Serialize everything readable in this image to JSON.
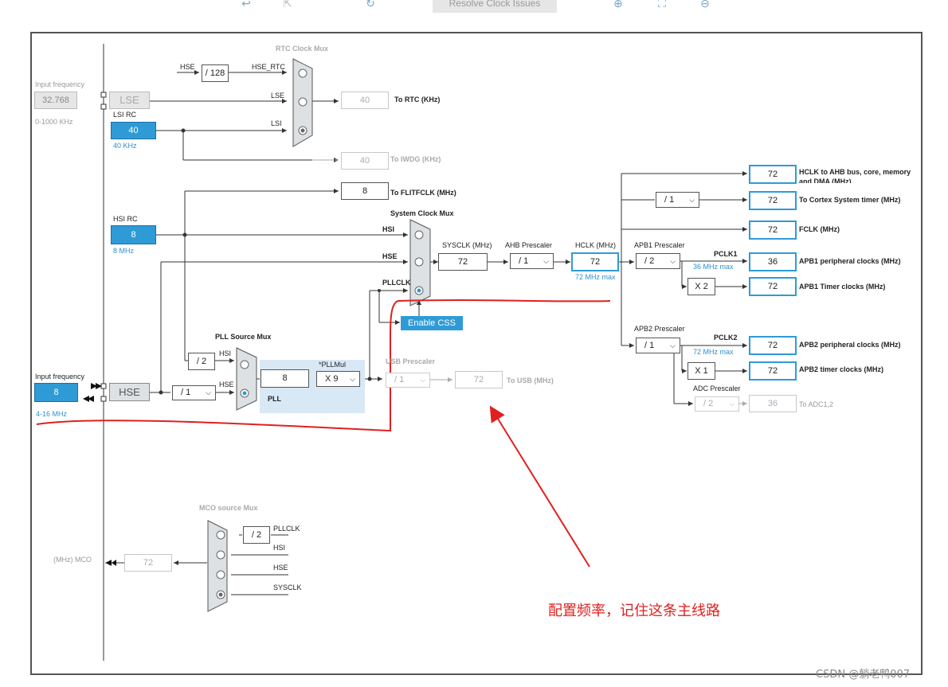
{
  "toolbar": {
    "resolve_label": "Resolve Clock Issues",
    "icons": [
      "undo-icon",
      "export-icon",
      "refresh-icon",
      "zoom-in-icon",
      "fit-icon",
      "zoom-out-icon"
    ]
  },
  "lse": {
    "input_label": "Input frequency",
    "value": "32.768",
    "range": "0-1000 KHz",
    "name": "LSE"
  },
  "lsi": {
    "name": "LSI RC",
    "value": "40",
    "unit": "40 KHz"
  },
  "rtc": {
    "mux_title": "RTC Clock Mux",
    "hse_label": "HSE",
    "div": "/ 128",
    "hse_rtc": "HSE_RTC",
    "lse_label": "LSE",
    "lsi_label": "LSI",
    "out_value": "40",
    "out_label": "To RTC (KHz)"
  },
  "iwdg": {
    "value": "40",
    "label": "To IWDG (KHz)"
  },
  "flitf": {
    "value": "8",
    "label": "To FLITFCLK (MHz)"
  },
  "hsi": {
    "name": "HSI RC",
    "value": "8",
    "unit": "8 MHz"
  },
  "sysmux": {
    "title": "System Clock Mux",
    "hsi": "HSI",
    "hse": "HSE",
    "pllclk": "PLLCLK",
    "css_label": "Enable CSS"
  },
  "sysclk": {
    "label": "SYSCLK (MHz)",
    "value": "72"
  },
  "ahb": {
    "label": "AHB Prescaler",
    "value": "/ 1"
  },
  "hclk": {
    "label": "HCLK (MHz)",
    "value": "72",
    "max": "72 MHz max"
  },
  "apb1": {
    "label": "APB1 Prescaler",
    "value": "/ 2",
    "pclk": "PCLK1",
    "max": "36 MHz max",
    "mult": "X 2"
  },
  "apb2": {
    "label": "APB2 Prescaler",
    "value": "/ 1",
    "pclk": "PCLK2",
    "max": "72 MHz max",
    "mult": "X 1"
  },
  "adc": {
    "label": "ADC Prescaler",
    "value": "/ 2",
    "out_value": "36",
    "out_label": "To ADC1,2"
  },
  "outputs": {
    "hclk_ahb": {
      "value": "72",
      "label": "HCLK to AHB bus, core, memory and DMA (MHz)"
    },
    "cortex_div": "/ 1",
    "cortex": {
      "value": "72",
      "label": "To Cortex System timer (MHz)"
    },
    "fclk": {
      "value": "72",
      "label": "FCLK (MHz)"
    },
    "apb1_periph": {
      "value": "36",
      "label": "APB1 peripheral clocks (MHz)"
    },
    "apb1_timer": {
      "value": "72",
      "label": "APB1 Timer clocks (MHz)"
    },
    "apb2_periph": {
      "value": "72",
      "label": "APB2 peripheral clocks (MHz)"
    },
    "apb2_timer": {
      "value": "72",
      "label": "APB2 timer clocks (MHz)"
    }
  },
  "hse": {
    "input_label": "Input frequency",
    "value": "8",
    "range": "4-16 MHz",
    "name": "HSE",
    "div": "/ 1"
  },
  "pll": {
    "src_title": "PLL Source Mux",
    "hsi_div": "/ 2",
    "hsi": "HSI",
    "hse": "HSE",
    "input_value": "8",
    "mul_label": "*PLLMul",
    "mul_value": "X 9",
    "name": "PLL"
  },
  "usb": {
    "label": "USB Prescaler",
    "value": "/ 1",
    "out_value": "72",
    "out_label": "To USB (MHz)"
  },
  "mco": {
    "title": "MCO source Mux",
    "div": "/ 2",
    "pllclk": "PLLCLK",
    "hsi": "HSI",
    "hse": "HSE",
    "sysclk": "SYSCLK",
    "out_value": "72",
    "out_label": "(MHz) MCO"
  },
  "annotation": {
    "text": "配置频率，记住这条主线路",
    "color": "#e02020"
  },
  "watermark": "CSDN @躺老鸭007"
}
